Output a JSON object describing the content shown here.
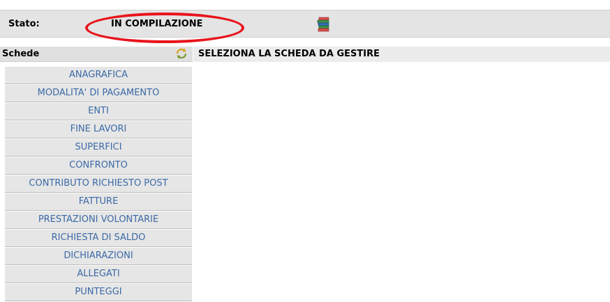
{
  "status": {
    "label": "Stato:",
    "value": "IN COMPILAZIONE"
  },
  "icons": {
    "status_icon": "books-icon",
    "sidebar_icon": "refresh-icon"
  },
  "sidebar": {
    "title": "Schede",
    "items": [
      {
        "label": "ANAGRAFICA"
      },
      {
        "label": "MODALITA' DI PAGAMENTO"
      },
      {
        "label": "ENTI"
      },
      {
        "label": "FINE LAVORI"
      },
      {
        "label": "SUPERFICI"
      },
      {
        "label": "CONFRONTO"
      },
      {
        "label": "CONTRIBUTO RICHIESTO POST"
      },
      {
        "label": "FATTURE"
      },
      {
        "label": "PRESTAZIONI VOLONTARIE"
      },
      {
        "label": "RICHIESTA DI SALDO"
      },
      {
        "label": "DICHIARAZIONI"
      },
      {
        "label": "ALLEGATI"
      },
      {
        "label": "PUNTEGGI"
      }
    ]
  },
  "main": {
    "title": "SELEZIONA LA SCHEDA DA GESTIRE"
  },
  "colors": {
    "menu_link": "#3b6aa6",
    "highlight_ring": "#e8141c",
    "status_bar_bg": "#e4e4e4"
  }
}
